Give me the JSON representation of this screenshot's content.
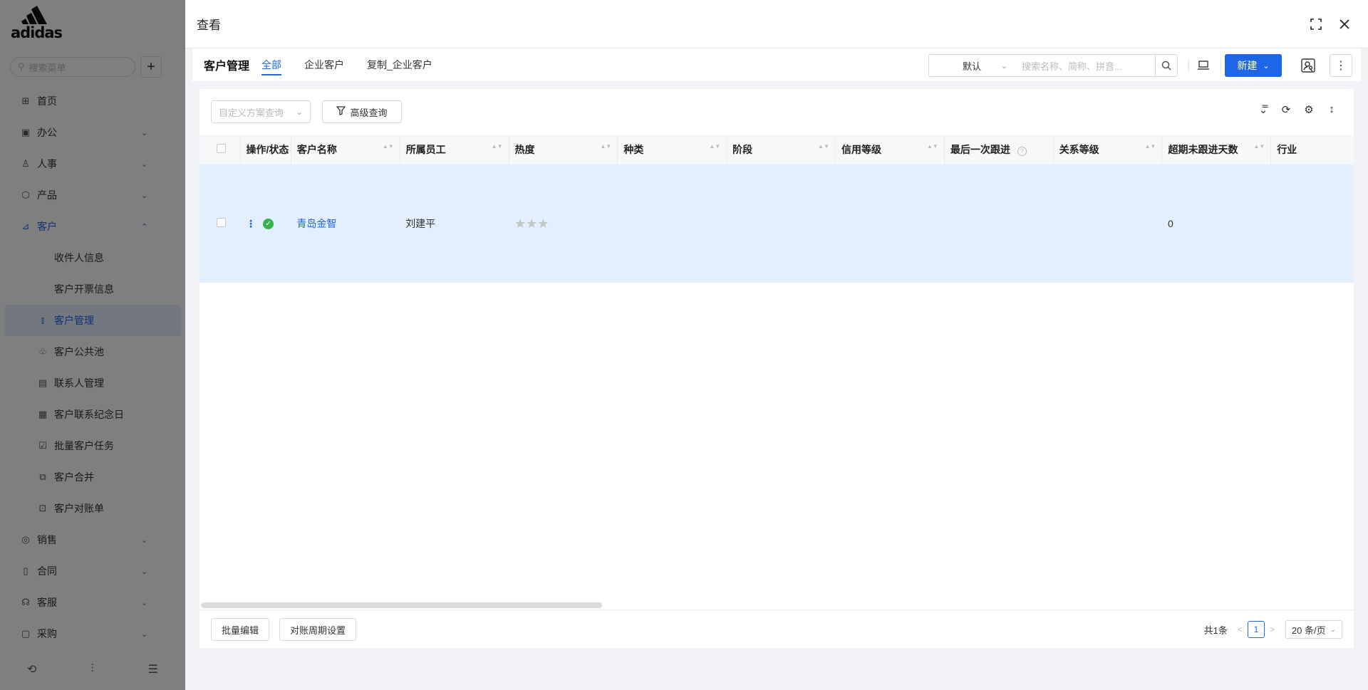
{
  "sidebar": {
    "logo_text": "adidas",
    "search_placeholder": "搜索菜单",
    "add_label": "+",
    "menu": [
      {
        "label": "首页",
        "icon": "home-icon"
      },
      {
        "label": "办公",
        "icon": "office-icon"
      },
      {
        "label": "人事",
        "icon": "person-icon"
      },
      {
        "label": "产品",
        "icon": "product-icon"
      },
      {
        "label": "客户",
        "icon": "customer-icon"
      }
    ],
    "customer_submenu": [
      {
        "label": "收件人信息"
      },
      {
        "label": "客户开票信息"
      },
      {
        "label": "客户管理",
        "icon": "chart-icon"
      },
      {
        "label": "客户公共池",
        "icon": "pool-icon"
      },
      {
        "label": "联系人管理",
        "icon": "contact-icon"
      },
      {
        "label": "客户联系纪念日",
        "icon": "calendar-icon"
      },
      {
        "label": "批量客户任务",
        "icon": "task-icon"
      },
      {
        "label": "客户合并",
        "icon": "merge-icon"
      },
      {
        "label": "客户对账单",
        "icon": "statement-icon"
      }
    ],
    "menu_bottom": [
      {
        "label": "销售",
        "icon": "sales-icon"
      },
      {
        "label": "合同",
        "icon": "contract-icon"
      },
      {
        "label": "客服",
        "icon": "service-icon"
      },
      {
        "label": "采购",
        "icon": "purchase-icon"
      }
    ]
  },
  "drawer": {
    "title": "查看"
  },
  "toolbar": {
    "module_title": "客户管理",
    "tabs": [
      {
        "label": "全部",
        "active": true
      },
      {
        "label": "企业客户",
        "active": false
      },
      {
        "label": "复制_企业客户",
        "active": false
      }
    ],
    "sort_select": "默认",
    "search_placeholder": "搜索名称、简称、拼音...",
    "new_button": "新建"
  },
  "filters": {
    "custom_query_placeholder": "自定义方案查询",
    "advanced_query": "高级查询"
  },
  "table": {
    "columns": [
      "操作/状态",
      "客户名称",
      "所属员工",
      "热度",
      "种类",
      "阶段",
      "信用等级",
      "最后一次跟进",
      "关系等级",
      "超期未跟进天数",
      "行业"
    ],
    "rows": [
      {
        "name": "青岛金智",
        "employee": "刘建平",
        "heat": "★★★",
        "kind": "",
        "stage": "",
        "credit": "",
        "last_follow": "",
        "relation": "",
        "overdue_days": "0",
        "industry": ""
      }
    ]
  },
  "footer": {
    "batch_edit": "批量编辑",
    "period_settings": "对账周期设置",
    "total": "共1条",
    "current_page": "1",
    "page_size": "20 条/页"
  },
  "colors": {
    "primary": "#1f66e6",
    "row_highlight": "#e3efff",
    "status_green": "#35b24a"
  }
}
